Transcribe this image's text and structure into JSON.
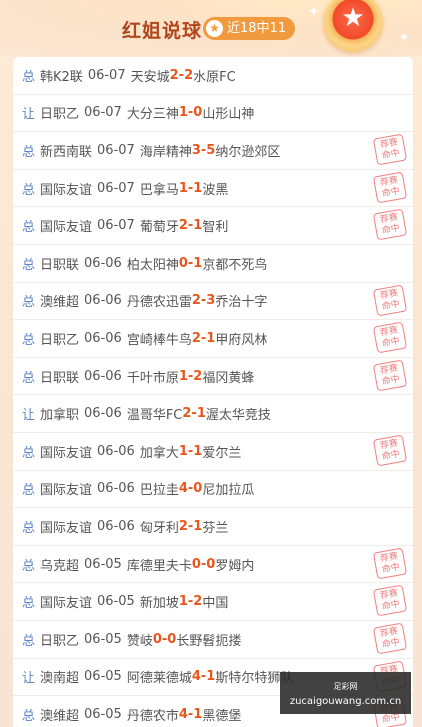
{
  "header": {
    "title": "红姐说球",
    "record_badge": "近18中11",
    "star_icon": "star-icon",
    "medal_icon": "medal-star-icon"
  },
  "stamp_text_line1": "荐赛",
  "stamp_text_line2": "命中",
  "matches": [
    {
      "type": "总",
      "league": "韩K2联",
      "date": "06-07",
      "home": "天安城",
      "home_score": "2",
      "sep": " - ",
      "away_score": "2",
      "away": "水原FC",
      "hit": false
    },
    {
      "type": "让",
      "league": "日职乙",
      "date": "06-07",
      "home": "大分三神",
      "home_score": "1",
      "sep": " - ",
      "away_score": "0",
      "away": "山形山神",
      "hit": false
    },
    {
      "type": "总",
      "league": "新西南联",
      "date": "06-07",
      "home": "海岸精神",
      "home_score": "3",
      "sep": " - ",
      "away_score": "5",
      "away": "纳尔逊郊区",
      "hit": true
    },
    {
      "type": "总",
      "league": "国际友谊",
      "date": "06-07",
      "home": "巴拿马",
      "home_score": "1",
      "sep": " - ",
      "away_score": "1",
      "away": "波黑",
      "hit": true
    },
    {
      "type": "总",
      "league": "国际友谊",
      "date": "06-07",
      "home": "葡萄牙",
      "home_score": "2",
      "sep": " - ",
      "away_score": "1",
      "away": "智利",
      "hit": true
    },
    {
      "type": "总",
      "league": "日职联",
      "date": "06-06",
      "home": "柏太阳神",
      "home_score": "0",
      "sep": " - ",
      "away_score": "1",
      "away": "京都不死鸟",
      "hit": false
    },
    {
      "type": "总",
      "league": "澳维超",
      "date": "06-06",
      "home": "丹德农迅雷",
      "home_score": "2",
      "sep": " - ",
      "away_score": "3",
      "away": "乔治十字",
      "hit": true
    },
    {
      "type": "总",
      "league": "日职乙",
      "date": "06-06",
      "home": "宫崎棒牛鸟",
      "home_score": "2",
      "sep": " - ",
      "away_score": "1",
      "away": "甲府风林",
      "hit": true
    },
    {
      "type": "总",
      "league": "日职联",
      "date": "06-06",
      "home": "千叶市原",
      "home_score": "1",
      "sep": " - ",
      "away_score": "2",
      "away": "福冈黄蜂",
      "hit": true
    },
    {
      "type": "让",
      "league": "加拿职",
      "date": "06-06",
      "home": "温哥华FC",
      "home_score": "2",
      "sep": " - ",
      "away_score": "1",
      "away": "渥太华竞技",
      "hit": false
    },
    {
      "type": "总",
      "league": "国际友谊",
      "date": "06-06",
      "home": "加拿大",
      "home_score": "1",
      "sep": " - ",
      "away_score": "1",
      "away": "爱尔兰",
      "hit": true
    },
    {
      "type": "总",
      "league": "国际友谊",
      "date": "06-06",
      "home": "巴拉圭",
      "home_score": "4",
      "sep": " - ",
      "away_score": "0",
      "away": "尼加拉瓜",
      "hit": false
    },
    {
      "type": "总",
      "league": "国际友谊",
      "date": "06-06",
      "home": "匈牙利",
      "home_score": "2",
      "sep": " - ",
      "away_score": "1",
      "away": "芬兰",
      "hit": false
    },
    {
      "type": "总",
      "league": "乌克超",
      "date": "06-05",
      "home": "库德里夫卡",
      "home_score": "0",
      "sep": " - ",
      "away_score": "0",
      "away": "罗姆内",
      "hit": true
    },
    {
      "type": "总",
      "league": "国际友谊",
      "date": "06-05",
      "home": "新加坡",
      "home_score": "1",
      "sep": " - ",
      "away_score": "2",
      "away": "中国",
      "hit": true
    },
    {
      "type": "总",
      "league": "日职乙",
      "date": "06-05",
      "home": "赞岐",
      "home_score": "0",
      "sep": " - ",
      "away_score": "0",
      "away": "长野髫扼搂",
      "hit": true
    },
    {
      "type": "让",
      "league": "澳南超",
      "date": "06-05",
      "home": "阿德莱德城",
      "home_score": "4",
      "sep": " - ",
      "away_score": "1",
      "away": "斯特尔特狮队",
      "hit": true
    },
    {
      "type": "总",
      "league": "澳维超",
      "date": "06-05",
      "home": "丹德农市",
      "home_score": "4",
      "sep": " - ",
      "away_score": "1",
      "away": "黑德堡",
      "hit": true
    }
  ],
  "watermark": {
    "line1": "足彩网",
    "line2": "zucaigouwang.com.cn"
  }
}
